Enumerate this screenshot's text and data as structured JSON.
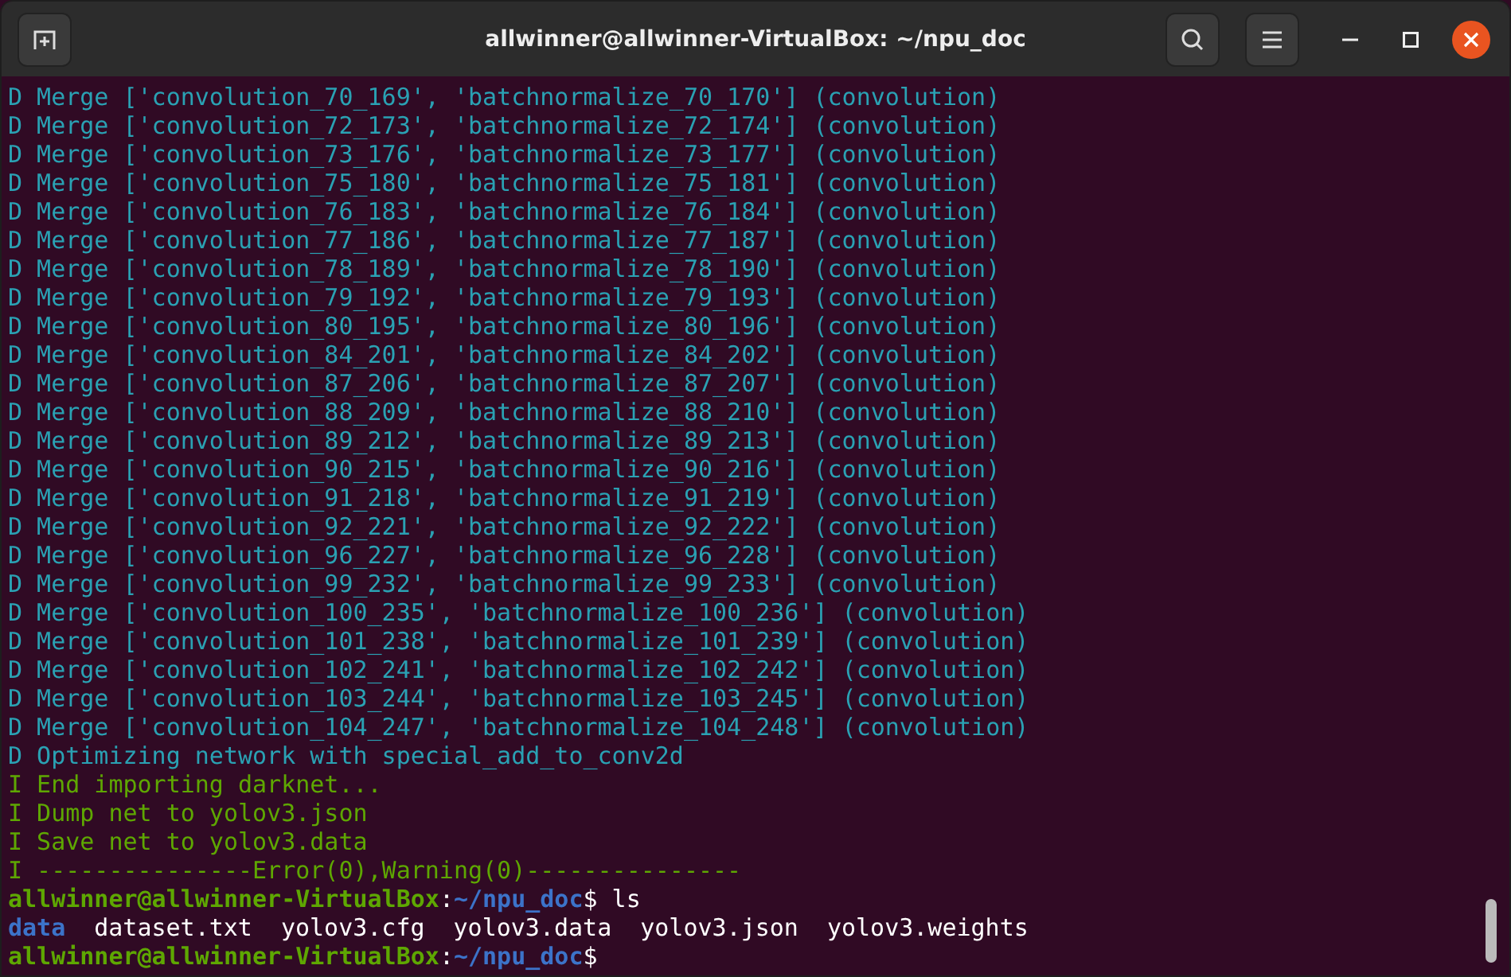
{
  "window": {
    "title": "allwinner@allwinner-VirtualBox: ~/npu_doc"
  },
  "lines": [
    {
      "kind": "debug",
      "text": "D Merge ['convolution_70_169', 'batchnormalize_70_170'] (convolution)"
    },
    {
      "kind": "debug",
      "text": "D Merge ['convolution_72_173', 'batchnormalize_72_174'] (convolution)"
    },
    {
      "kind": "debug",
      "text": "D Merge ['convolution_73_176', 'batchnormalize_73_177'] (convolution)"
    },
    {
      "kind": "debug",
      "text": "D Merge ['convolution_75_180', 'batchnormalize_75_181'] (convolution)"
    },
    {
      "kind": "debug",
      "text": "D Merge ['convolution_76_183', 'batchnormalize_76_184'] (convolution)"
    },
    {
      "kind": "debug",
      "text": "D Merge ['convolution_77_186', 'batchnormalize_77_187'] (convolution)"
    },
    {
      "kind": "debug",
      "text": "D Merge ['convolution_78_189', 'batchnormalize_78_190'] (convolution)"
    },
    {
      "kind": "debug",
      "text": "D Merge ['convolution_79_192', 'batchnormalize_79_193'] (convolution)"
    },
    {
      "kind": "debug",
      "text": "D Merge ['convolution_80_195', 'batchnormalize_80_196'] (convolution)"
    },
    {
      "kind": "debug",
      "text": "D Merge ['convolution_84_201', 'batchnormalize_84_202'] (convolution)"
    },
    {
      "kind": "debug",
      "text": "D Merge ['convolution_87_206', 'batchnormalize_87_207'] (convolution)"
    },
    {
      "kind": "debug",
      "text": "D Merge ['convolution_88_209', 'batchnormalize_88_210'] (convolution)"
    },
    {
      "kind": "debug",
      "text": "D Merge ['convolution_89_212', 'batchnormalize_89_213'] (convolution)"
    },
    {
      "kind": "debug",
      "text": "D Merge ['convolution_90_215', 'batchnormalize_90_216'] (convolution)"
    },
    {
      "kind": "debug",
      "text": "D Merge ['convolution_91_218', 'batchnormalize_91_219'] (convolution)"
    },
    {
      "kind": "debug",
      "text": "D Merge ['convolution_92_221', 'batchnormalize_92_222'] (convolution)"
    },
    {
      "kind": "debug",
      "text": "D Merge ['convolution_96_227', 'batchnormalize_96_228'] (convolution)"
    },
    {
      "kind": "debug",
      "text": "D Merge ['convolution_99_232', 'batchnormalize_99_233'] (convolution)"
    },
    {
      "kind": "debug",
      "text": "D Merge ['convolution_100_235', 'batchnormalize_100_236'] (convolution)"
    },
    {
      "kind": "debug",
      "text": "D Merge ['convolution_101_238', 'batchnormalize_101_239'] (convolution)"
    },
    {
      "kind": "debug",
      "text": "D Merge ['convolution_102_241', 'batchnormalize_102_242'] (convolution)"
    },
    {
      "kind": "debug",
      "text": "D Merge ['convolution_103_244', 'batchnormalize_103_245'] (convolution)"
    },
    {
      "kind": "debug",
      "text": "D Merge ['convolution_104_247', 'batchnormalize_104_248'] (convolution)"
    },
    {
      "kind": "debug",
      "text": "D Optimizing network with special_add_to_conv2d"
    },
    {
      "kind": "info",
      "text": "I End importing darknet..."
    },
    {
      "kind": "info",
      "text": "I Dump net to yolov3.json"
    },
    {
      "kind": "info",
      "text": "I Save net to yolov3.data"
    },
    {
      "kind": "info",
      "text": "I ---------------Error(0),Warning(0)---------------"
    },
    {
      "kind": "prompt",
      "user": "allwinner@allwinner-VirtualBox",
      "separator": ":",
      "path": "~/npu_doc",
      "sign": "$",
      "command": "ls"
    },
    {
      "kind": "listing",
      "entries": [
        {
          "name": "data",
          "color": "#3c73c9"
        },
        {
          "name": "dataset.txt",
          "color": "#ffffff"
        },
        {
          "name": "yolov3.cfg",
          "color": "#ffffff"
        },
        {
          "name": "yolov3.data",
          "color": "#ffffff"
        },
        {
          "name": "yolov3.json",
          "color": "#ffffff"
        },
        {
          "name": "yolov3.weights",
          "color": "#ffffff"
        }
      ]
    },
    {
      "kind": "prompt",
      "user": "allwinner@allwinner-VirtualBox",
      "separator": ":",
      "path": "~/npu_doc",
      "sign": "$"
    }
  ]
}
